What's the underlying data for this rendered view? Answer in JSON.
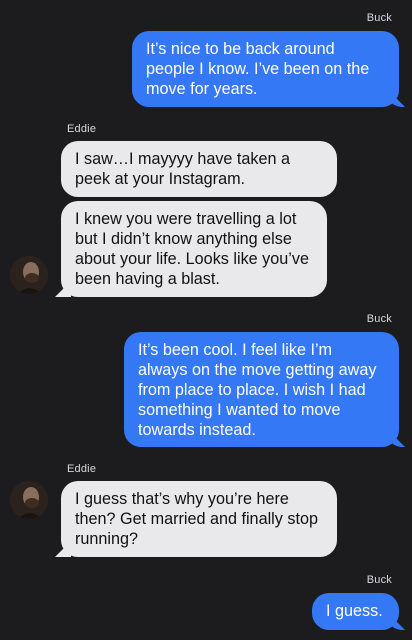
{
  "messages": [
    {
      "sender": "Buck",
      "direction": "outgoing",
      "text": "It’s nice to be back around people I know. I’ve been on the move for years."
    },
    {
      "sender": "Eddie",
      "direction": "incoming",
      "text": "I saw…I mayyyy have taken a peek at your Instagram."
    },
    {
      "sender": "Eddie",
      "direction": "incoming",
      "text": "I knew you were travelling a lot but I didn’t know anything else about your life. Looks like you’ve been having a blast."
    },
    {
      "sender": "Buck",
      "direction": "outgoing",
      "text": "It’s been cool. I feel like I’m always on the move getting away from place to place. I wish I had something I wanted to move towards instead."
    },
    {
      "sender": "Eddie",
      "direction": "incoming",
      "text": "I guess that’s why you’re here then? Get married and finally stop running?"
    },
    {
      "sender": "Buck",
      "direction": "outgoing",
      "text": "I guess."
    }
  ],
  "colors": {
    "background": "#1c1c1e",
    "outgoing_bubble": "#3478f6",
    "incoming_bubble": "#e9e9eb"
  },
  "icons": {
    "avatar": "contact-avatar-photo"
  }
}
